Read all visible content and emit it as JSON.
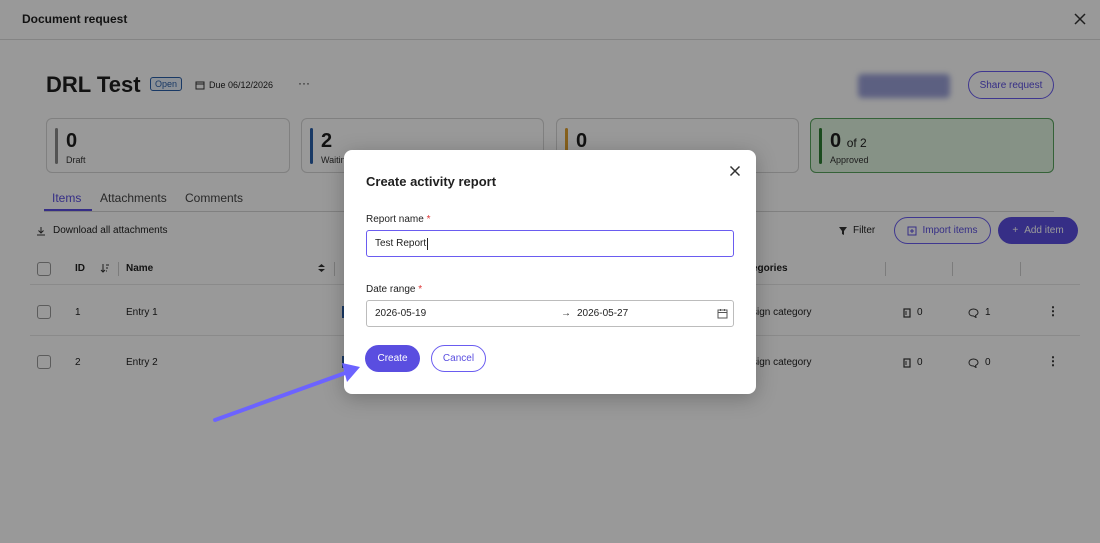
{
  "window": {
    "title": "Document request"
  },
  "request": {
    "title": "DRL Test",
    "status": "Open",
    "due": "Due 06/12/2026",
    "more": "···",
    "share_label": "Share request"
  },
  "stats": [
    {
      "value": "0",
      "label": "Draft",
      "color": "#8a8a8a"
    },
    {
      "value": "2",
      "label": "Waitin",
      "color": "#2b5fa8"
    },
    {
      "value": "0",
      "label": "",
      "color": "#e0a030"
    },
    {
      "value": "0",
      "suffix": "of 2",
      "label": "Approved",
      "color": "#2e7d32"
    }
  ],
  "tabs": [
    {
      "label": "Items",
      "active": true
    },
    {
      "label": "Attachments",
      "active": false
    },
    {
      "label": "Comments",
      "active": false
    }
  ],
  "toolbar": {
    "download_all": "Download all attachments",
    "filter": "Filter",
    "import": "Import items",
    "add": "Add item"
  },
  "table": {
    "headers": {
      "id": "ID",
      "name": "Name",
      "categories": "egories"
    },
    "rows": [
      {
        "id": "1",
        "name": "Entry 1",
        "category": "sign category",
        "attachments": "0",
        "comments": "1"
      },
      {
        "id": "2",
        "name": "Entry 2",
        "category": "sign category",
        "attachments": "0",
        "comments": "0"
      }
    ]
  },
  "modal": {
    "title": "Create activity report",
    "report_name_label": "Report name",
    "report_name_value": "Test Report",
    "date_range_label": "Date range",
    "required_mark": "*",
    "date_from": "2026-05-19",
    "date_to": "2026-05-27",
    "arrow": "→",
    "create_label": "Create",
    "cancel_label": "Cancel"
  },
  "colors": {
    "accent": "#5a4ee0",
    "approved_bg": "#dff3df"
  }
}
